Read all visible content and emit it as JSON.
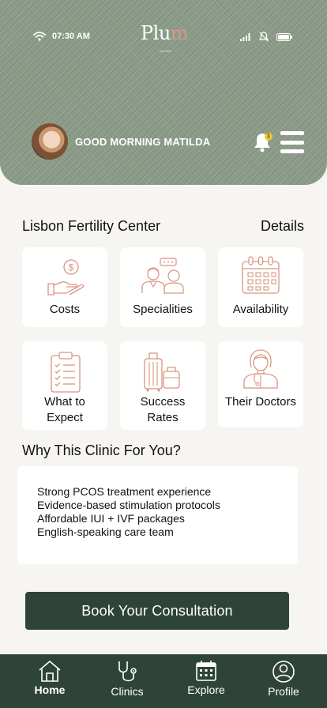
{
  "status_bar": {
    "time": "07:30 AM"
  },
  "brand": {
    "logo": "Plum",
    "logo_accent": "m",
    "logo_main": "Plu",
    "tagline": "est.2021"
  },
  "header": {
    "greeting": "GOOD MORNING MATILDA",
    "notification_count": "1"
  },
  "clinic": {
    "name": "Lisbon Fertility Center",
    "details_label": "Details"
  },
  "cards": [
    {
      "label": "Costs",
      "icon": "hand-coin-icon"
    },
    {
      "label": "Specialities",
      "icon": "consultation-icon"
    },
    {
      "label": "Availability",
      "icon": "calendar-icon"
    },
    {
      "label_line1": "What to",
      "label_line2": "Expect",
      "icon": "checklist-icon"
    },
    {
      "label_line1": "Success",
      "label_line2": "Rates",
      "icon": "luggage-icon"
    },
    {
      "label": "Their Doctors",
      "icon": "doctor-icon"
    }
  ],
  "why": {
    "title": "Why This Clinic For You?",
    "points": [
      "Strong PCOS treatment experience",
      "Evidence-based stimulation protocols",
      "Affordable IUI + IVF packages",
      "English-speaking care team"
    ]
  },
  "cta": {
    "label": "Book Your Consultation"
  },
  "nav": [
    {
      "label": "Home",
      "icon": "home-icon",
      "active": true
    },
    {
      "label": "Clinics",
      "icon": "stethoscope-icon",
      "active": false
    },
    {
      "label": "Explore",
      "icon": "calendar-icon",
      "active": false
    },
    {
      "label": "Profile",
      "icon": "profile-icon",
      "active": false
    }
  ],
  "colors": {
    "header_bg": "#8b9c88",
    "accent_icon": "#d9957f",
    "primary_dark": "#2f4438",
    "page_bg": "#f7f5f1",
    "badge": "#e8c53a"
  }
}
